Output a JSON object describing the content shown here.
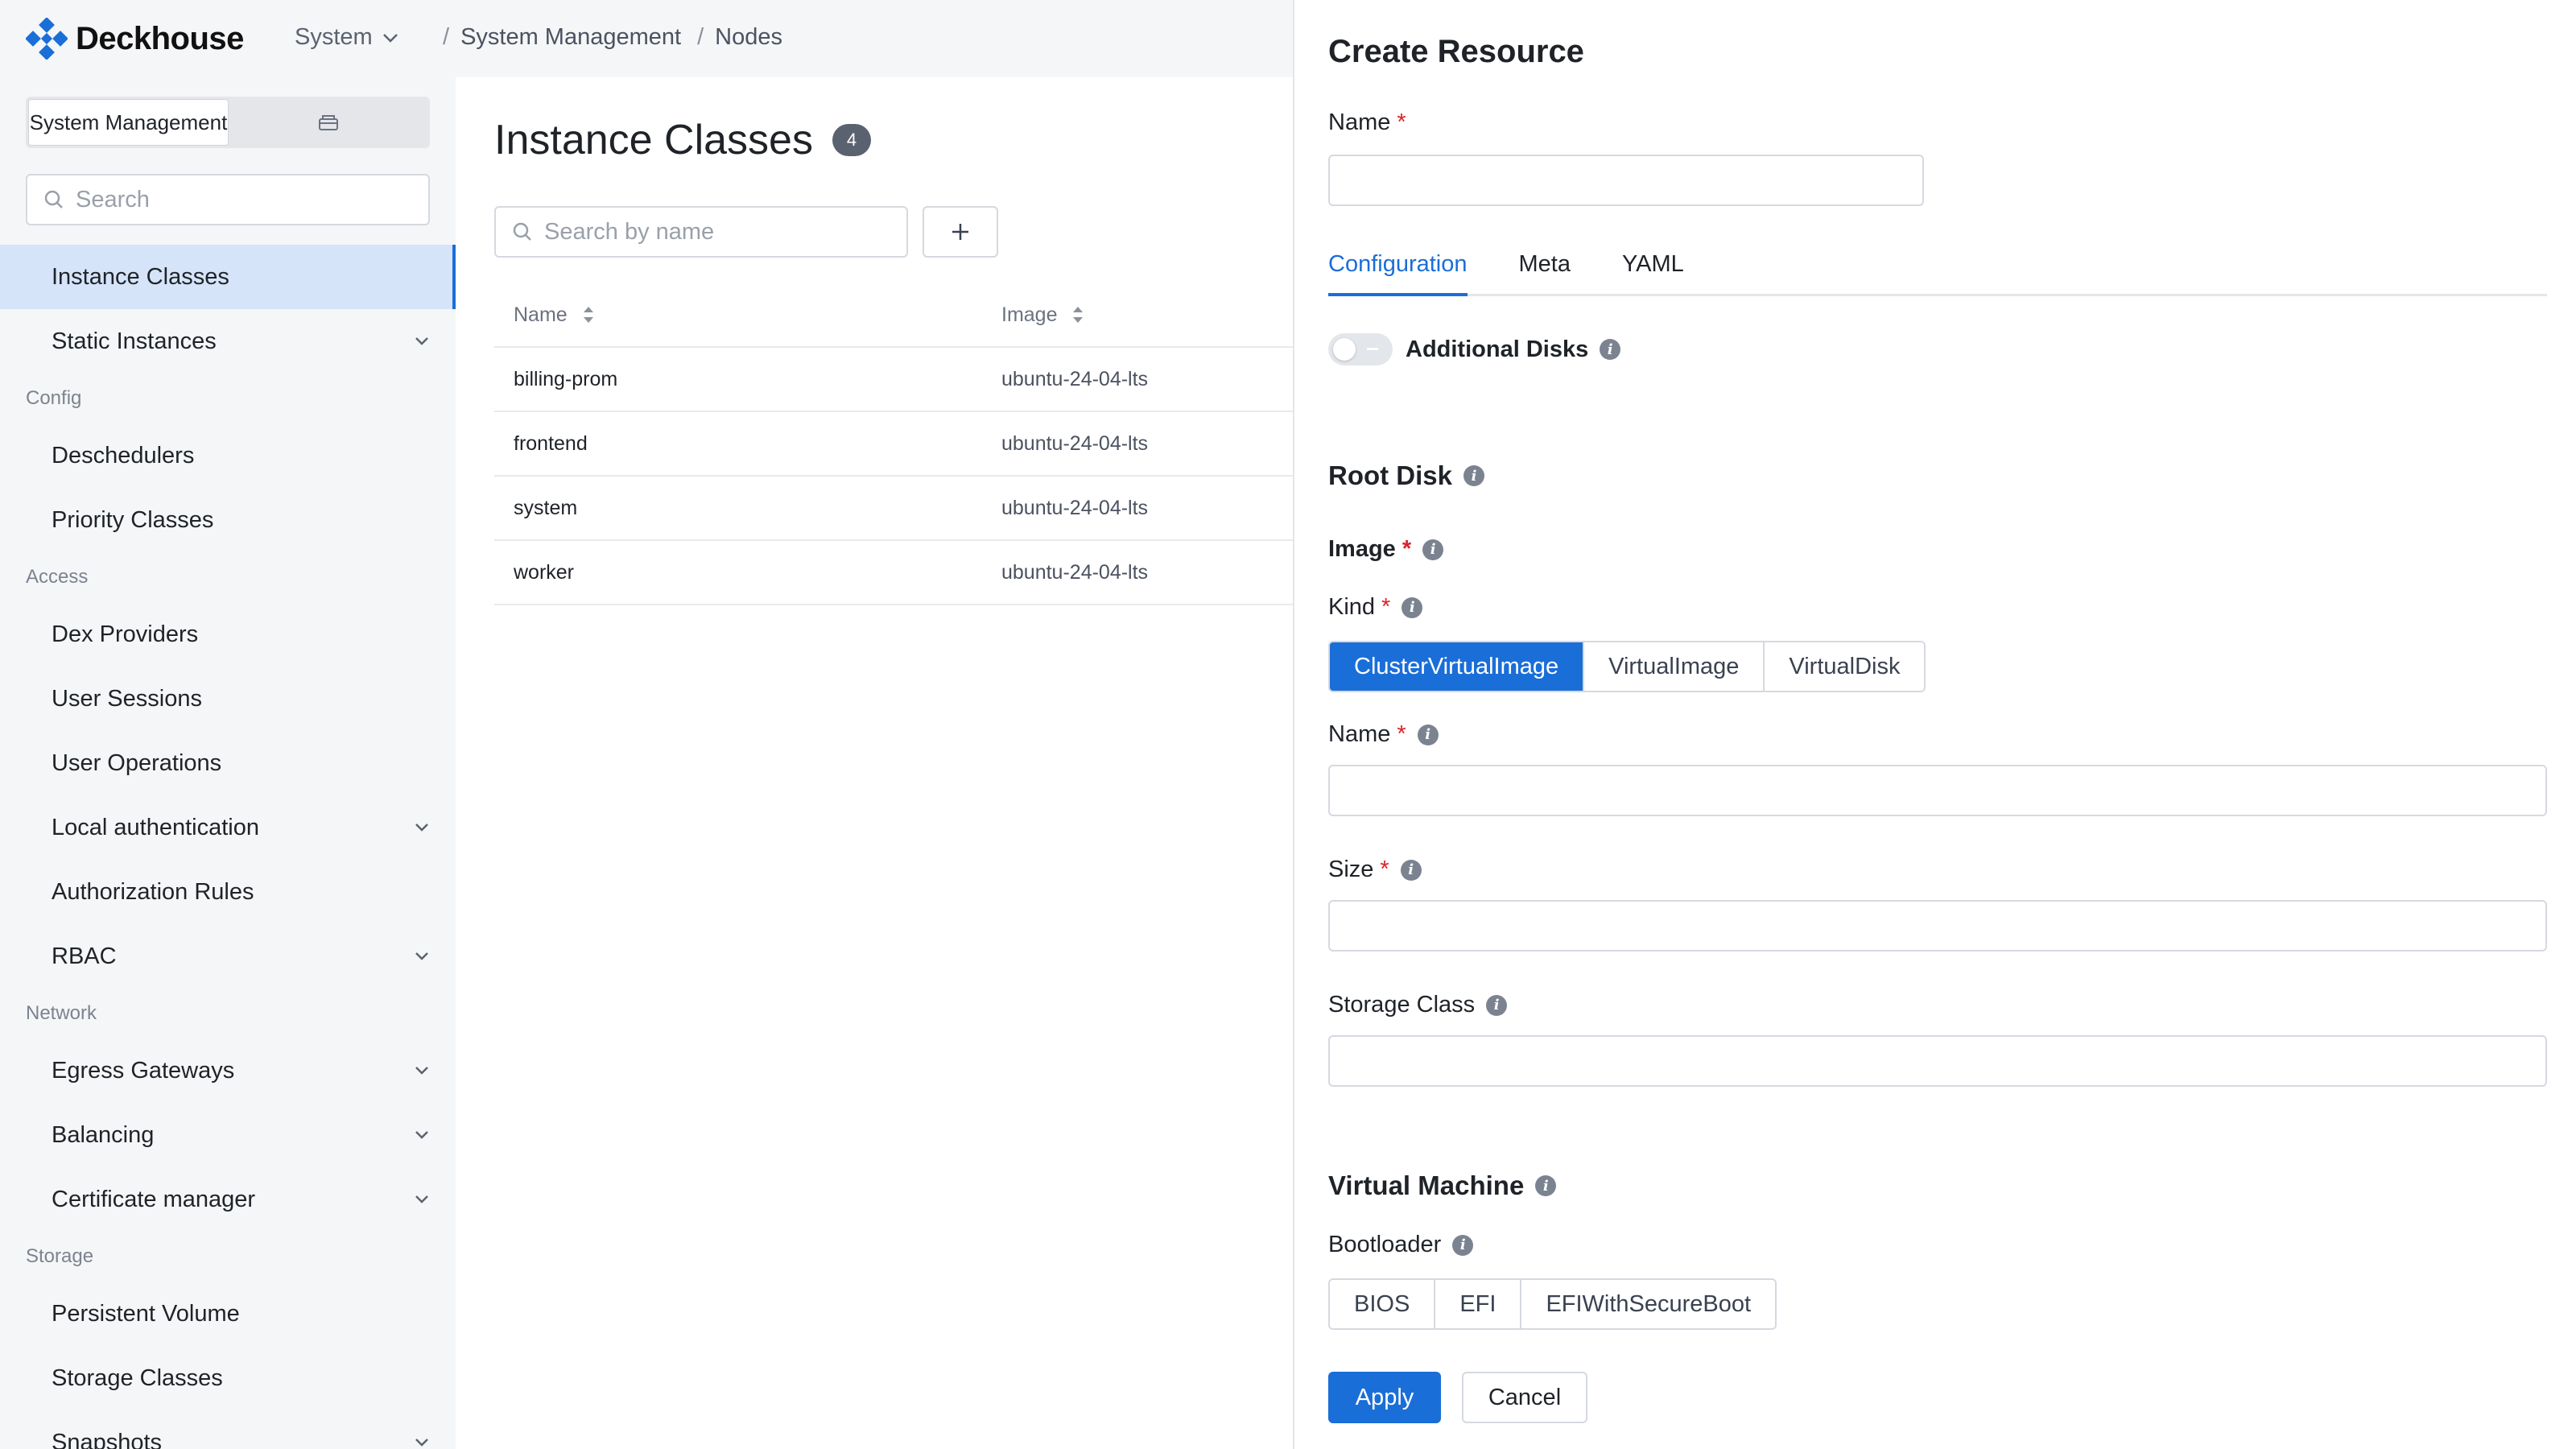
{
  "app": {
    "logo_text": "Deckhouse",
    "context_select": "System"
  },
  "breadcrumb": [
    "System Management",
    "Nodes"
  ],
  "sidebar": {
    "segment": {
      "active_label": "System Management",
      "second_icon": "box-icon"
    },
    "search_placeholder": "Search",
    "items": [
      {
        "type": "item",
        "label": "Instance Classes",
        "active": true,
        "expandable": false
      },
      {
        "type": "item",
        "label": "Static Instances",
        "active": false,
        "expandable": true
      },
      {
        "type": "group",
        "label": "Config"
      },
      {
        "type": "item",
        "label": "Deschedulers",
        "active": false,
        "expandable": false
      },
      {
        "type": "item",
        "label": "Priority Classes",
        "active": false,
        "expandable": false
      },
      {
        "type": "group",
        "label": "Access"
      },
      {
        "type": "item",
        "label": "Dex Providers",
        "active": false,
        "expandable": false
      },
      {
        "type": "item",
        "label": "User Sessions",
        "active": false,
        "expandable": false
      },
      {
        "type": "item",
        "label": "User Operations",
        "active": false,
        "expandable": false
      },
      {
        "type": "item",
        "label": "Local authentication",
        "active": false,
        "expandable": true
      },
      {
        "type": "item",
        "label": "Authorization Rules",
        "active": false,
        "expandable": false
      },
      {
        "type": "item",
        "label": "RBAC",
        "active": false,
        "expandable": true
      },
      {
        "type": "group",
        "label": "Network"
      },
      {
        "type": "item",
        "label": "Egress Gateways",
        "active": false,
        "expandable": true
      },
      {
        "type": "item",
        "label": "Balancing",
        "active": false,
        "expandable": true
      },
      {
        "type": "item",
        "label": "Certificate manager",
        "active": false,
        "expandable": true
      },
      {
        "type": "group",
        "label": "Storage"
      },
      {
        "type": "item",
        "label": "Persistent Volume",
        "active": false,
        "expandable": false
      },
      {
        "type": "item",
        "label": "Storage Classes",
        "active": false,
        "expandable": false
      },
      {
        "type": "item",
        "label": "Snapshots",
        "active": false,
        "expandable": true
      }
    ]
  },
  "main": {
    "title": "Instance Classes",
    "count": "4",
    "search_placeholder": "Search by name",
    "table": {
      "columns": [
        "Name",
        "Image"
      ],
      "rows": [
        [
          "billing-prom",
          "ubuntu-24-04-lts"
        ],
        [
          "frontend",
          "ubuntu-24-04-lts"
        ],
        [
          "system",
          "ubuntu-24-04-lts"
        ],
        [
          "worker",
          "ubuntu-24-04-lts"
        ]
      ]
    }
  },
  "drawer": {
    "title": "Create Resource",
    "name_label": "Name",
    "name_value": "",
    "tabs": [
      "Configuration",
      "Meta",
      "YAML"
    ],
    "active_tab": "Configuration",
    "additional_disks_label": "Additional Disks",
    "additional_disks_enabled": false,
    "root_disk": {
      "section_title": "Root Disk",
      "image_label": "Image",
      "kind_label": "Kind",
      "kind_options": [
        "ClusterVirtualImage",
        "VirtualImage",
        "VirtualDisk"
      ],
      "kind_selected": "ClusterVirtualImage",
      "name_label": "Name",
      "name_value": "",
      "size_label": "Size",
      "size_value": "",
      "storage_class_label": "Storage Class",
      "storage_class_value": ""
    },
    "virtual_machine": {
      "section_title": "Virtual Machine",
      "bootloader_label": "Bootloader",
      "bootloader_options": [
        "BIOS",
        "EFI",
        "EFIWithSecureBoot"
      ],
      "bootloader_selected": ""
    },
    "apply_label": "Apply",
    "cancel_label": "Cancel"
  },
  "colors": {
    "accent": "#1a6ed8",
    "sidebar_bg": "#f5f6f8",
    "active_item_bg": "#d6e4fa",
    "required": "#d8242a"
  }
}
